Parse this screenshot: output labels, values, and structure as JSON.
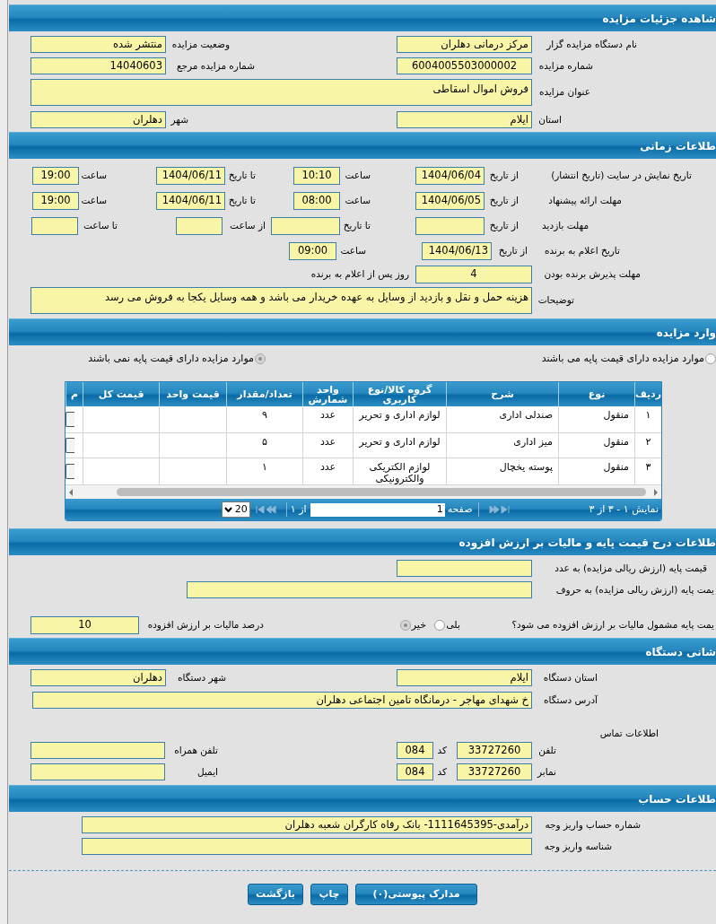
{
  "sections": [
    {
      "title": "شاهده جزئیات مزایده",
      "rows": [
        {
          "cells": [
            {
              "kind": "label",
              "text": "نام دستگاه مزایده گزار"
            },
            {
              "kind": "field",
              "value": "مرکز درمانی دهلران"
            },
            {
              "kind": "label",
              "text": "وضعیت مزایده"
            },
            {
              "kind": "field",
              "value": "منتشر شده"
            }
          ]
        },
        {
          "cells": [
            {
              "kind": "label",
              "text": "شماره مزایده"
            },
            {
              "kind": "field",
              "value": "6004005503000002"
            },
            {
              "kind": "label",
              "text": "شماره مزایده مرجع"
            },
            {
              "kind": "field",
              "value": "14040603"
            }
          ]
        },
        {
          "cells": [
            {
              "kind": "label",
              "text": "عنوان مزایده"
            },
            {
              "kind": "area",
              "value": "فروش اموال اسقاطی"
            }
          ]
        },
        {
          "cells": [
            {
              "kind": "label",
              "text": "استان"
            },
            {
              "kind": "field",
              "value": "ایلام"
            },
            {
              "kind": "label",
              "text": "شهر"
            },
            {
              "kind": "field",
              "value": "دهلران"
            }
          ]
        }
      ]
    },
    {
      "title": "طلاعات زمانی",
      "rows": [
        {
          "cells": [
            {
              "kind": "label",
              "text": "تاریخ نمایش در سایت (تاریخ انتشار)"
            },
            {
              "kind": "label",
              "text": "از تاریخ"
            },
            {
              "kind": "field",
              "value": "1404/06/04"
            },
            {
              "kind": "label",
              "text": "ساعت"
            },
            {
              "kind": "field",
              "value": "10:10"
            },
            {
              "kind": "label",
              "text": "تا تاریخ"
            },
            {
              "kind": "field",
              "value": "1404/06/11"
            },
            {
              "kind": "label",
              "text": "ساعت"
            },
            {
              "kind": "field",
              "value": "19:00"
            }
          ]
        },
        {
          "cells": [
            {
              "kind": "label",
              "text": "مهلت ارائه پیشنهاد"
            },
            {
              "kind": "label",
              "text": "از تاریخ"
            },
            {
              "kind": "field",
              "value": "1404/06/05"
            },
            {
              "kind": "label",
              "text": "ساعت"
            },
            {
              "kind": "field",
              "value": "08:00"
            },
            {
              "kind": "label",
              "text": "تا تاریخ"
            },
            {
              "kind": "field",
              "value": "1404/06/11"
            },
            {
              "kind": "label",
              "text": "ساعت"
            },
            {
              "kind": "field",
              "value": "19:00"
            }
          ]
        },
        {
          "cells": [
            {
              "kind": "label",
              "text": "مهلت بازدید"
            },
            {
              "kind": "label",
              "text": "از تاریخ"
            },
            {
              "kind": "field"
            },
            {
              "kind": "label",
              "text": "تا تاریخ"
            },
            {
              "kind": "field"
            },
            {
              "kind": "label",
              "text": "از ساعت"
            },
            {
              "kind": "field"
            },
            {
              "kind": "label",
              "text": "تا ساعت"
            },
            {
              "kind": "field"
            }
          ]
        },
        {
          "cells": [
            {
              "kind": "label",
              "text": "تاریخ اعلام به برنده"
            },
            {
              "kind": "label",
              "text": "از تاریخ"
            },
            {
              "kind": "field",
              "value": "1404/06/13"
            },
            {
              "kind": "label",
              "text": "ساعت"
            },
            {
              "kind": "field",
              "value": "09:00"
            }
          ]
        },
        {
          "cells": [
            {
              "kind": "label",
              "text": "مهلت پذیرش برنده بودن"
            },
            {
              "kind": "field",
              "value": "4",
              "suffix": "روز پس از اعلام به برنده"
            }
          ]
        },
        {
          "cells": [
            {
              "kind": "label",
              "text": "توضیحات"
            },
            {
              "kind": "area",
              "value": "هزینه حمل و نقل و بازدید از وسایل به عهده خریدار می باشد و همه وسایل یکجا به فروش می رسد"
            }
          ]
        }
      ]
    },
    {
      "title": "وارد مزایده",
      "rows": [
        {
          "cells": [
            {
              "kind": "radio",
              "text": "موارد مزایده دارای قیمت پایه می باشند",
              "selected": false
            },
            {
              "kind": "radio",
              "text": "موارد مزایده دارای قیمت پایه نمی باشند",
              "selected": true
            }
          ]
        }
      ],
      "table": {
        "columns": [
          "ردیف",
          "نوع",
          "شرح",
          "گروه کالا/نوع کاربری",
          "واحد شمارش",
          "تعداد/مقدار",
          "قیمت واحد",
          "قیمت کل",
          "م"
        ],
        "rows": [
          {
            "cells": [
              "۱",
              "منقول",
              "صندلی اداری",
              "لوازم اداری و تحریر",
              "عدد",
              "۹"
            ]
          },
          {
            "cells": [
              "۲",
              "منقول",
              "میز اداری",
              "لوازم اداری و تحریر",
              "عدد",
              "۵"
            ]
          },
          {
            "cells": [
              "۳",
              "منقول",
              "پوسته یخچال",
              "لوازم الکتریکی والکترونیکی",
              "عدد",
              "۱"
            ]
          }
        ],
        "pager": {
          "summary": "نمایش ۱ - ۳ از ۳",
          "page_label": "صفحه",
          "page": "1",
          "of": "از ۱",
          "page_size": "20"
        }
      }
    },
    {
      "title": "طلاعات درج قیمت پایه و مالیات بر ارزش افزوده",
      "rows": [
        {
          "cells": [
            {
              "kind": "label",
              "text": "قیمت پایه (ارزش ریالی مزایده) به عدد"
            },
            {
              "kind": "field"
            }
          ]
        },
        {
          "cells": [
            {
              "kind": "label",
              "text": "یمت پایه (ارزش ریالی مزایده) به حروف"
            },
            {
              "kind": "field"
            }
          ]
        },
        {
          "cells": [
            {
              "kind": "label",
              "text": "یمت پایه مشمول مالیات بر ارزش افزوده می شود؟"
            },
            {
              "kind": "radio_trailing",
              "text": "بلی",
              "selected": false
            },
            {
              "kind": "radio_trailing",
              "text": "خیر",
              "selected": true
            },
            {
              "kind": "label",
              "text": "درصد مالیات بر ارزش افزوده"
            },
            {
              "kind": "field",
              "value": "10"
            }
          ]
        }
      ]
    },
    {
      "title": "شانی دستگاه",
      "rows": [
        {
          "cells": [
            {
              "kind": "label",
              "text": "استان دستگاه"
            },
            {
              "kind": "field",
              "value": "ایلام"
            },
            {
              "kind": "label",
              "text": "شهر دستگاه"
            },
            {
              "kind": "field",
              "value": "دهلران"
            }
          ]
        },
        {
          "cells": [
            {
              "kind": "label",
              "text": "آدرس دستگاه"
            },
            {
              "kind": "field",
              "value": "خ شهدای مهاجر - درمانگاه تامین اجتماعی دهلران"
            }
          ]
        },
        {
          "cells": [
            {
              "kind": "label",
              "text": "اطلاعات تماس"
            }
          ]
        },
        {
          "cells": [
            {
              "kind": "label",
              "text": "تلفن"
            },
            {
              "kind": "field",
              "value": "33727260",
              "code_label": "کد",
              "code": "084"
            },
            {
              "kind": "label",
              "text": "تلفن همراه"
            },
            {
              "kind": "field"
            }
          ]
        },
        {
          "cells": [
            {
              "kind": "label",
              "text": "نمابر"
            },
            {
              "kind": "field",
              "value": "33727260",
              "code_label": "کد",
              "code": "084"
            },
            {
              "kind": "label",
              "text": "ایمیل"
            },
            {
              "kind": "field"
            }
          ]
        }
      ]
    },
    {
      "title": "طلاعات حساب",
      "rows": [
        {
          "cells": [
            {
              "kind": "label",
              "text": "شماره حساب واریز وجه"
            },
            {
              "kind": "field",
              "value": "درآمدی-1111645395- بانک رفاه کارگران شعبه دهلران"
            }
          ]
        },
        {
          "cells": [
            {
              "kind": "label",
              "text": "شناسه واریز وجه"
            },
            {
              "kind": "field"
            }
          ]
        }
      ]
    }
  ],
  "buttons": [
    "مدارک پیوستی(۰)",
    "چاپ",
    "بازگشت"
  ]
}
